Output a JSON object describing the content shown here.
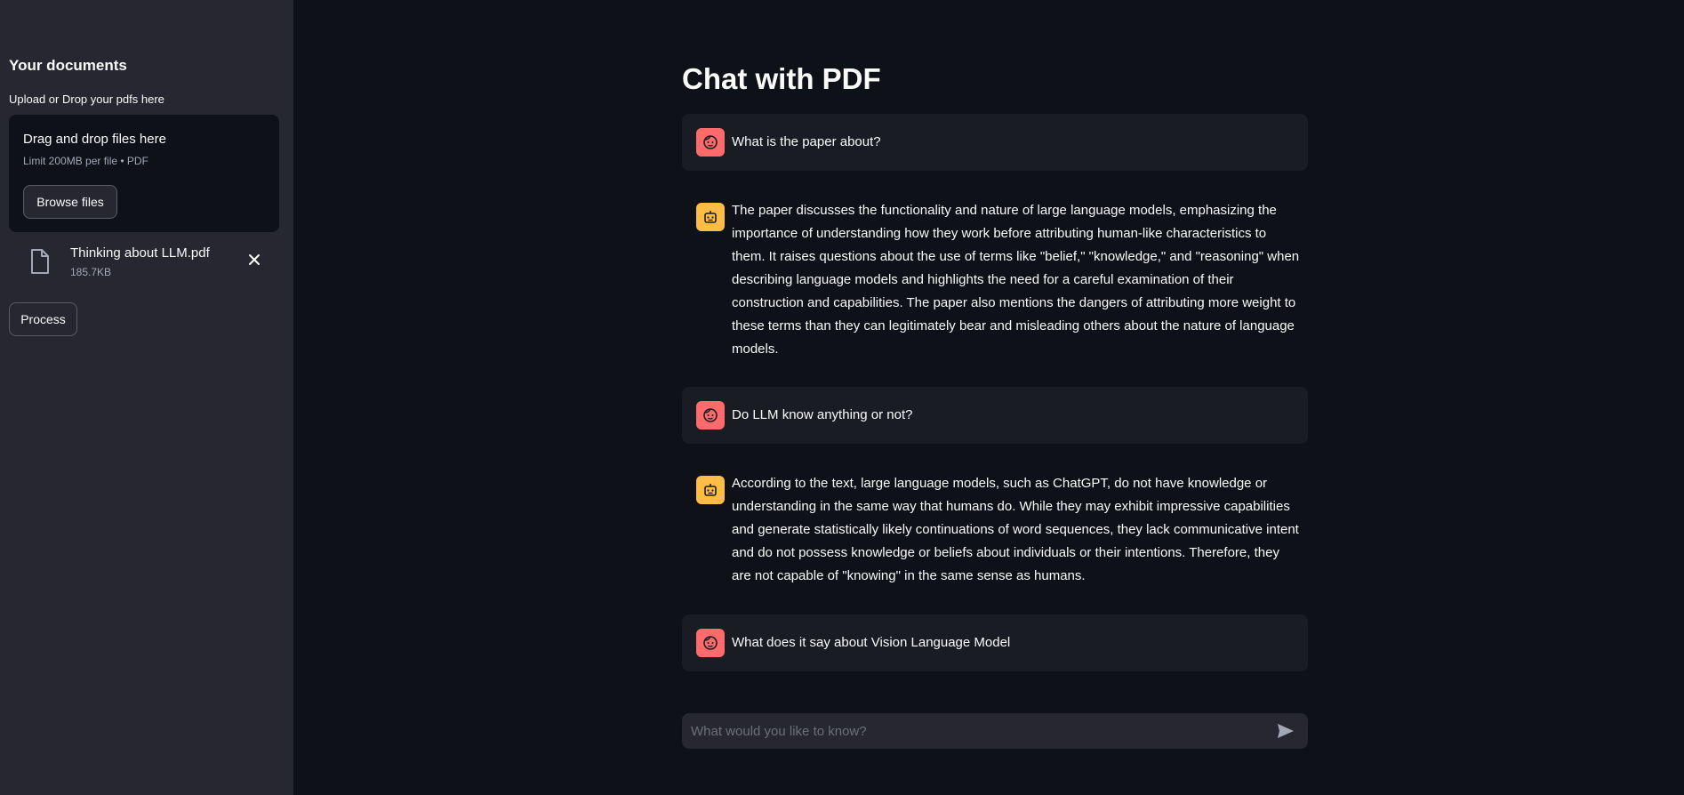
{
  "sidebar": {
    "heading": "Your documents",
    "upload_label": "Upload or Drop your pdfs here",
    "dropzone": {
      "title": "Drag and drop files here",
      "limit": "Limit 200MB per file • PDF",
      "browse_label": "Browse files"
    },
    "file": {
      "name": "Thinking about LLM.pdf",
      "size": "185.7KB",
      "icon": "file-icon"
    },
    "process_label": "Process"
  },
  "main": {
    "title": "Chat with PDF",
    "messages": [
      {
        "role": "user",
        "text": "What is the paper about?"
      },
      {
        "role": "assistant",
        "text": "The paper discusses the functionality and nature of large language models, emphasizing the importance of understanding how they work before attributing human-like characteristics to them. It raises questions about the use of terms like \"belief,\" \"knowledge,\" and \"reasoning\" when describing language models and highlights the need for a careful examination of their construction and capabilities. The paper also mentions the dangers of attributing more weight to these terms than they can legitimately bear and misleading others about the nature of language models."
      },
      {
        "role": "user",
        "text": "Do LLM know anything or not?"
      },
      {
        "role": "assistant",
        "text": "According to the text, large language models, such as ChatGPT, do not have knowledge or understanding in the same way that humans do. While they may exhibit impressive capabilities and generate statistically likely continuations of word sequences, they lack communicative intent and do not possess knowledge or beliefs about individuals or their intentions. Therefore, they are not capable of \"knowing\" in the same sense as humans."
      },
      {
        "role": "user",
        "text": "What does it say about Vision Language Model"
      }
    ],
    "input": {
      "placeholder": "What would you like to know?",
      "value": ""
    }
  },
  "colors": {
    "sidebar_bg": "#262730",
    "main_bg": "#0e1117",
    "user_avatar": "#ff6b6b",
    "assistant_avatar": "#ffbd45",
    "user_msg_bg": "#1a1c24"
  }
}
